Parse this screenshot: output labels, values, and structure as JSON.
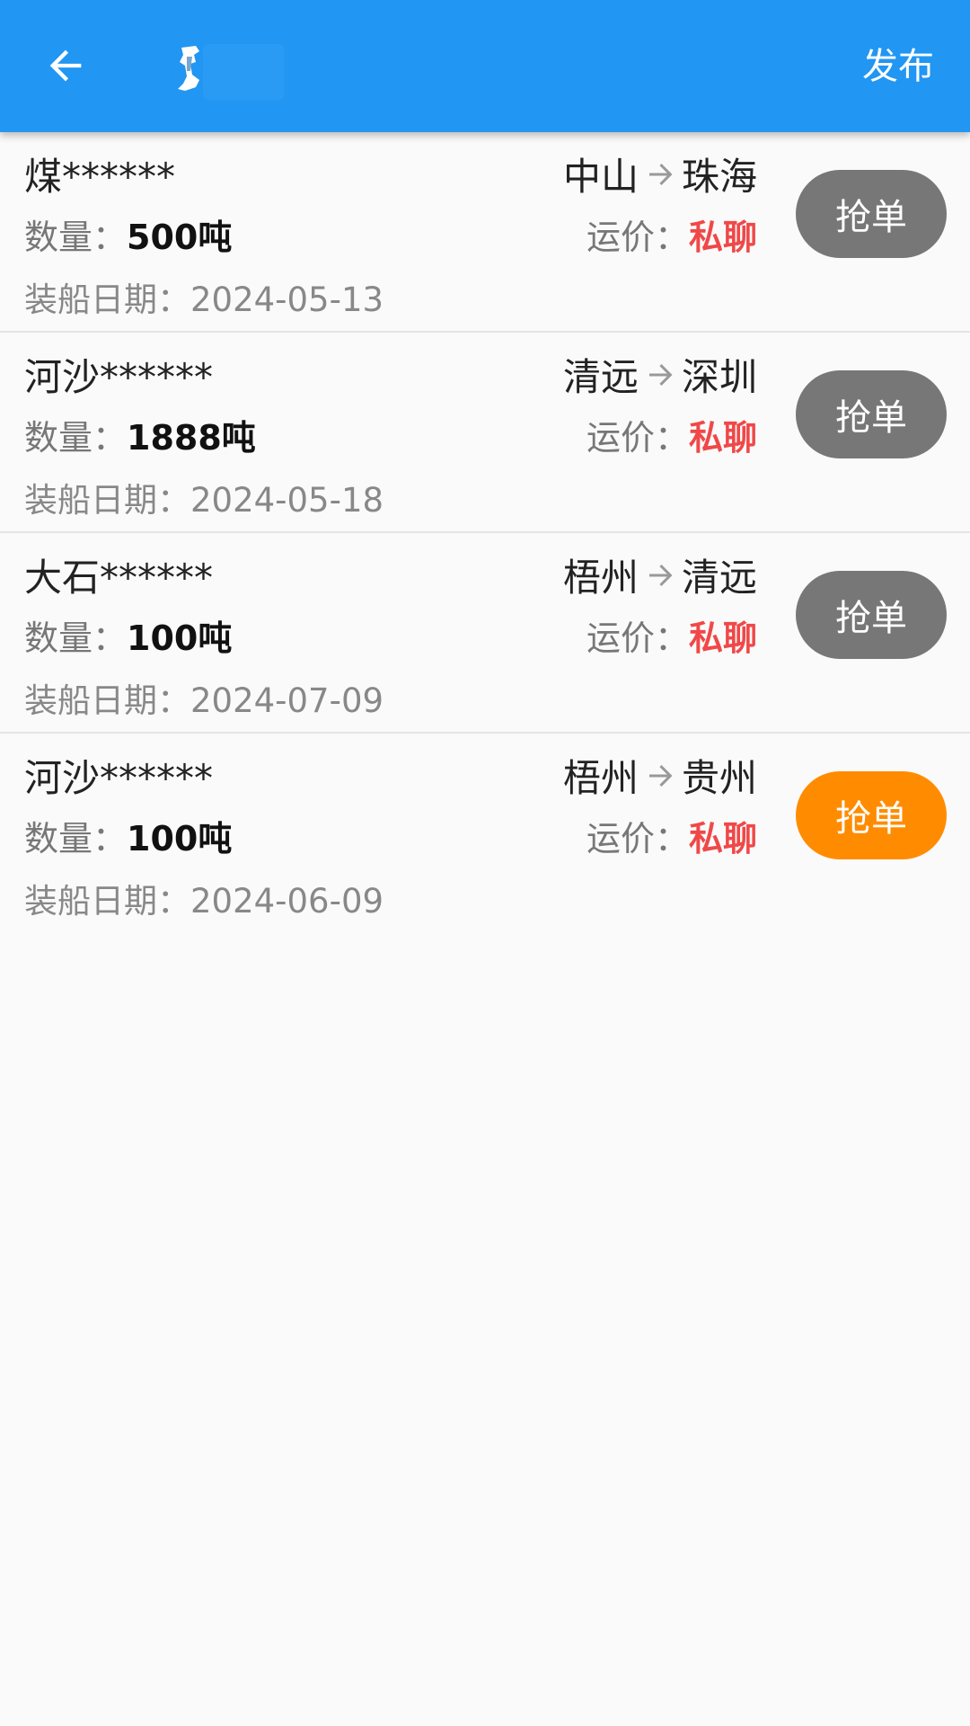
{
  "header": {
    "back_icon": "arrow-left-icon",
    "logo_icon": "app-logo-icon",
    "publish_label": "发布",
    "color": "#2196f3"
  },
  "labels": {
    "quantity": "数量：",
    "load_date": "装船日期：",
    "freight": "运价："
  },
  "orders": [
    {
      "cargo": "煤******",
      "from": "中山",
      "to": "珠海",
      "quantity": "500吨",
      "price": "私聊",
      "date": "2024-05-13",
      "button_label": "抢单",
      "button_color": "#777777"
    },
    {
      "cargo": "河沙******",
      "from": "清远",
      "to": "深圳",
      "quantity": "1888吨",
      "price": "私聊",
      "date": "2024-05-18",
      "button_label": "抢单",
      "button_color": "#777777"
    },
    {
      "cargo": "大石******",
      "from": "梧州",
      "to": "清远",
      "quantity": "100吨",
      "price": "私聊",
      "date": "2024-07-09",
      "button_label": "抢单",
      "button_color": "#777777"
    },
    {
      "cargo": "河沙******",
      "from": "梧州",
      "to": "贵州",
      "quantity": "100吨",
      "price": "私聊",
      "date": "2024-06-09",
      "button_label": "抢单",
      "button_color": "#ff8c00"
    }
  ]
}
